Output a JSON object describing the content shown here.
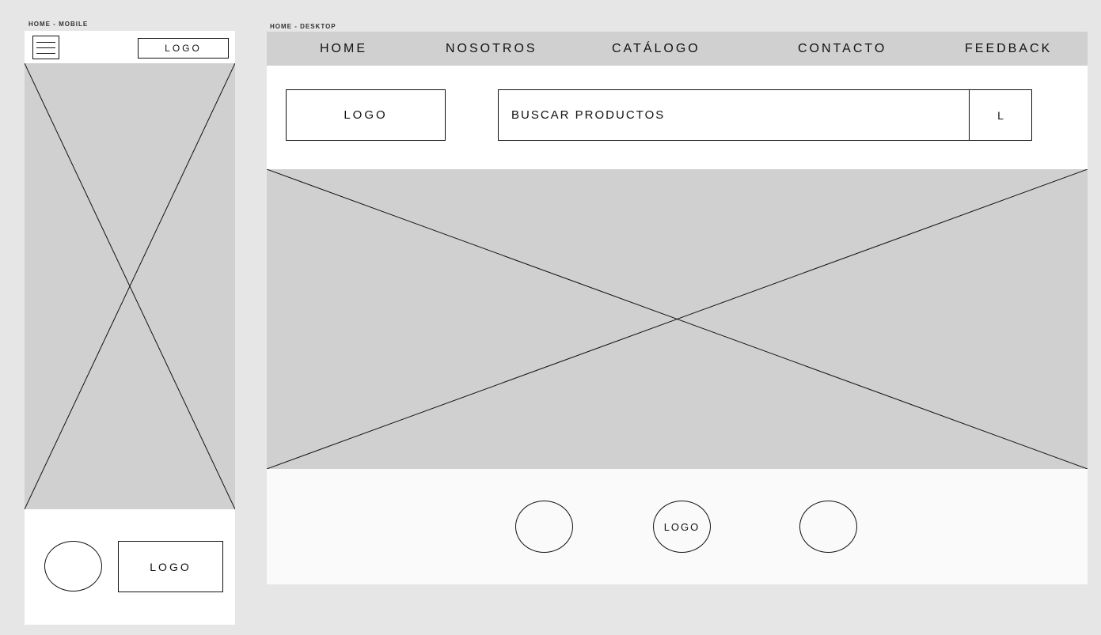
{
  "mobile": {
    "frame_label": "HOME - MOBILE",
    "header_logo": "LOGO",
    "footer_logo": "LOGO"
  },
  "desktop": {
    "frame_label": "HOME - DESKTOP",
    "nav": {
      "home": "HOME",
      "nosotros": "NOSOTROS",
      "catalogo": "CATÁLOGO",
      "contacto": "CONTACTO",
      "feedback": "FEEDBACK"
    },
    "header_logo": "LOGO",
    "search_text": "BUSCAR PRODUCTOS",
    "search_button": "L",
    "footer_logo": "LOGO"
  },
  "colors": {
    "canvas": "#e6e6e6",
    "placeholder_fill": "#d0d0d0",
    "frame_bg": "#ffffff",
    "stroke": "#111111"
  }
}
